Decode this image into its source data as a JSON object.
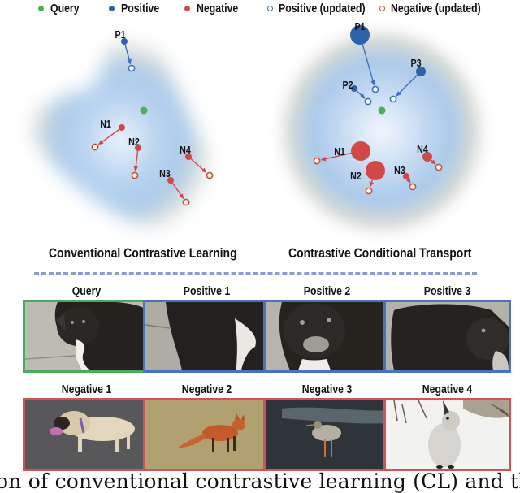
{
  "legend": [
    {
      "label": "Query",
      "marker": "filled",
      "color": "#4caf50"
    },
    {
      "label": "Positive",
      "marker": "filled",
      "color": "#2e62a8"
    },
    {
      "label": "Negative",
      "marker": "filled",
      "color": "#d04848"
    },
    {
      "label": "Positive (updated)",
      "marker": "ring",
      "color": "#3e6fc0"
    },
    {
      "label": "Negative (updated)",
      "marker": "ring",
      "color": "#c9502e"
    }
  ],
  "colors": {
    "query": "#4caf50",
    "positive": "#2e62a8",
    "negative": "#d04848",
    "positive_updated": "#3e6fc0",
    "negative_updated": "#c9502e",
    "query_frame": "#4caa5c",
    "positive_frame": "#4a72c0",
    "negative_frame": "#cf5358",
    "divider": "#8f98d8"
  },
  "panels": [
    {
      "title": "Conventional Contrastive Learning",
      "points": [
        {
          "label": "P1",
          "type": "positive",
          "weight": "small"
        },
        {
          "label": "N1",
          "type": "negative",
          "weight": "small"
        },
        {
          "label": "N2",
          "type": "negative",
          "weight": "small"
        },
        {
          "label": "N3",
          "type": "negative",
          "weight": "small"
        },
        {
          "label": "N4",
          "type": "negative",
          "weight": "small"
        }
      ]
    },
    {
      "title": "Contrastive Conditional Transport",
      "points": [
        {
          "label": "P1",
          "type": "positive",
          "weight": "large"
        },
        {
          "label": "P2",
          "type": "positive",
          "weight": "small"
        },
        {
          "label": "P3",
          "type": "positive",
          "weight": "medium"
        },
        {
          "label": "N1",
          "type": "negative",
          "weight": "large"
        },
        {
          "label": "N2",
          "type": "negative",
          "weight": "large"
        },
        {
          "label": "N3",
          "type": "negative",
          "weight": "small"
        },
        {
          "label": "N4",
          "type": "negative",
          "weight": "medium"
        }
      ]
    }
  ],
  "samples": {
    "top_row": [
      {
        "title": "Query",
        "role": "query",
        "subject": "black dog looking up"
      },
      {
        "title": "Positive 1",
        "role": "positive",
        "subject": "black dog body crop"
      },
      {
        "title": "Positive  2",
        "role": "positive",
        "subject": "black dog face crop"
      },
      {
        "title": "Positive 3",
        "role": "positive",
        "subject": "black dog side crop"
      }
    ],
    "bottom_row": [
      {
        "title": "Negative 1",
        "role": "negative",
        "subject": "tan pug dog on asphalt"
      },
      {
        "title": "Negative 2",
        "role": "negative",
        "subject": "red fox in field"
      },
      {
        "title": "Negative 3",
        "role": "negative",
        "subject": "shorebird on wet ground"
      },
      {
        "title": "Negative 4",
        "role": "negative",
        "subject": "white hare in snow"
      }
    ]
  },
  "caption": "son of conventional contrastive learning (CL) and the propose"
}
